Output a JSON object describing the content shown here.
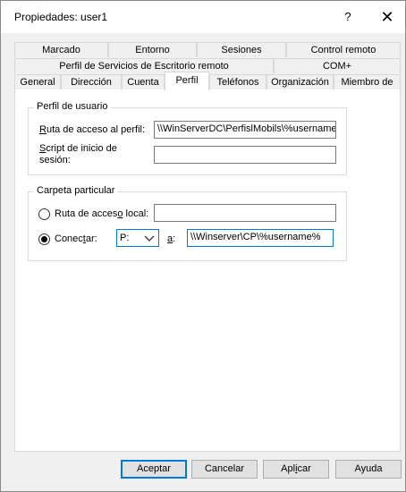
{
  "window": {
    "title": "Propiedades: user1",
    "help": "?",
    "close": "✕"
  },
  "tabs_row1": [
    "Marcado",
    "Entorno",
    "Sesiones",
    "Control remoto"
  ],
  "tabs_row2": [
    "Perfil de Servicios de Escritorio remoto",
    "COM+"
  ],
  "tabs_row3": [
    "General",
    "Dirección",
    "Cuenta",
    "Perfil",
    "Teléfonos",
    "Organización",
    "Miembro de"
  ],
  "active_tab": "Perfil",
  "profile": {
    "legend": "Perfil de usuario",
    "path_label": "uta de acceso al perfil:",
    "path_label_key": "R",
    "path_value": "\\\\WinServerDC\\PerfislMobils\\%username",
    "script_label_key": "S",
    "script_label1": "cript de inicio de",
    "script_label2": "sesión:",
    "script_value": ""
  },
  "home": {
    "legend": "Carpeta particular",
    "local_label_pre": "Ruta de acces",
    "local_label_key": "o",
    "local_label_post": " local:",
    "local_value": "",
    "connect_label_pre": "Conec",
    "connect_label_key": "t",
    "connect_label_post": "ar:",
    "connect_selected": true,
    "drive": "P:",
    "to_label": "a",
    "to_suffix": ":",
    "to_value": "\\\\Winserver\\CP\\%username%"
  },
  "buttons": {
    "accept": "Aceptar",
    "cancel": "Cancelar",
    "apply_pre": "Apl",
    "apply_key": "i",
    "apply_post": "car",
    "help": "Ayuda"
  }
}
